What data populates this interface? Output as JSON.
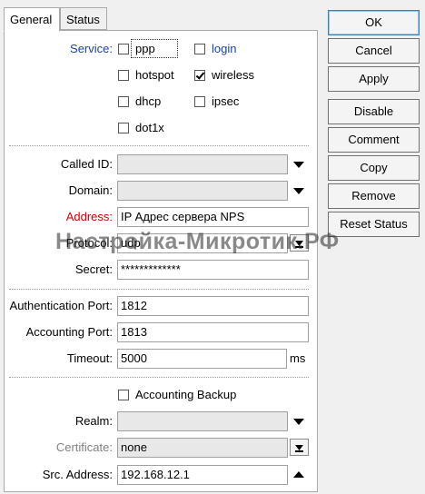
{
  "tabs": [
    {
      "label": "General"
    },
    {
      "label": "Status"
    }
  ],
  "service": {
    "label": "Service:",
    "options": [
      {
        "label": "ppp",
        "checked": false
      },
      {
        "label": "login",
        "checked": false
      },
      {
        "label": "hotspot",
        "checked": false
      },
      {
        "label": "wireless",
        "checked": true
      },
      {
        "label": "dhcp",
        "checked": false
      },
      {
        "label": "ipsec",
        "checked": false
      },
      {
        "label": "dot1x",
        "checked": false
      }
    ]
  },
  "fields": {
    "called_id": {
      "label": "Called ID:",
      "value": ""
    },
    "domain": {
      "label": "Domain:",
      "value": ""
    },
    "address": {
      "label": "Address:",
      "value": "IP Адрес сервера NPS"
    },
    "protocol": {
      "label": "Protocol:",
      "value": "udp"
    },
    "secret": {
      "label": "Secret:",
      "value": "*************"
    },
    "auth_port": {
      "label": "Authentication Port:",
      "value": "1812"
    },
    "acct_port": {
      "label": "Accounting Port:",
      "value": "1813"
    },
    "timeout": {
      "label": "Timeout:",
      "value": "5000",
      "unit": "ms"
    },
    "acct_backup": {
      "label": "Accounting Backup",
      "checked": false
    },
    "realm": {
      "label": "Realm:",
      "value": ""
    },
    "certificate": {
      "label": "Certificate:",
      "value": "none"
    },
    "src_address": {
      "label": "Src. Address:",
      "value": "192.168.12.1"
    }
  },
  "buttons": [
    "OK",
    "Cancel",
    "Apply",
    "Disable",
    "Comment",
    "Copy",
    "Remove",
    "Reset Status"
  ],
  "watermark": "Настройка-Микротик.РФ",
  "colors": {
    "service_label": "#1a3fb8",
    "address_label": "#d40000",
    "certificate_label": "#808080",
    "link_label": "#1a3fb8"
  }
}
